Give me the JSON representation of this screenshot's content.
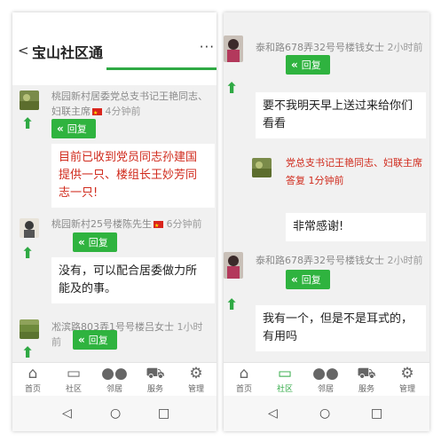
{
  "left_panel": {
    "header": {
      "back_glyph": "<",
      "title": "宝山社区通",
      "more_glyph": "···"
    },
    "posts": [
      {
        "author": "桃园新村居委党总支书记王艳同志、妇联主席",
        "time": "4分钟前",
        "reply_label": "回复",
        "content": "目前已收到党员同志孙建国提供一只、楼组长王妙芳同志一只!"
      },
      {
        "author": "桃园新村25号楼陈先生",
        "time": "6分钟前",
        "reply_label": "回复",
        "content": "没有，可以配合居委做力所能及的事。"
      },
      {
        "author": "凇滨路803弄1号号楼吕女士",
        "time": "1小时前",
        "reply_label": "回复"
      }
    ],
    "nav": [
      "首页",
      "社区",
      "邻居",
      "服务",
      "管理"
    ]
  },
  "right_panel": {
    "posts": [
      {
        "author": "泰和路678弄32号号楼钱女士",
        "time": "2小时前",
        "reply_label": "回复",
        "content": "要不我明天早上送过来给你们看看"
      },
      {
        "author": "党总支书记王艳同志、妇联主席",
        "reply_to": "答复",
        "time": "1分钟前",
        "content": "非常感谢!"
      },
      {
        "author": "泰和路678弄32号号楼钱女士",
        "time": "2小时前",
        "reply_label": "回复",
        "content": "我有一个，但是不是耳式的，有用吗"
      }
    ],
    "nav": [
      "首页",
      "社区",
      "邻居",
      "服务",
      "管理"
    ]
  },
  "icons": {
    "up": "up-arrow-icon",
    "reply": "reply-arrow-icon",
    "flag": "chinese-flag-icon",
    "nav": [
      "home-icon",
      "cast-icon",
      "people-icon",
      "cart-icon",
      "gear-icon"
    ],
    "system": [
      "back-triangle-icon",
      "home-circle-icon",
      "recents-square-icon"
    ]
  },
  "colors": {
    "accent": "#2fa944",
    "alert_text": "#d02a1c",
    "background": "#f1f1f1"
  }
}
